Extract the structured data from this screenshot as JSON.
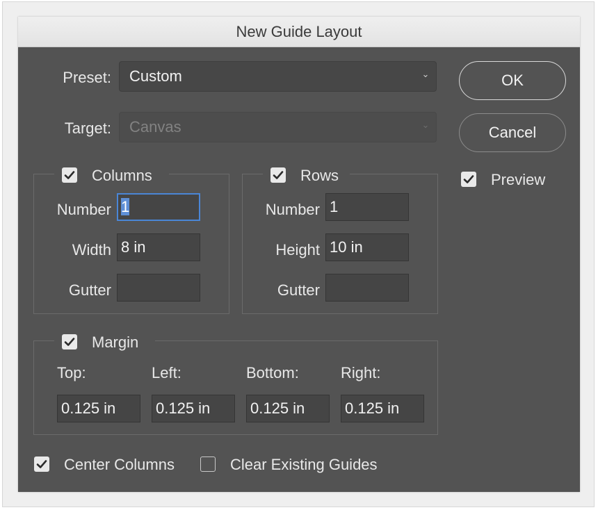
{
  "dialog": {
    "title": "New Guide Layout"
  },
  "preset": {
    "label": "Preset:",
    "value": "Custom"
  },
  "target": {
    "label": "Target:",
    "value": "Canvas"
  },
  "buttons": {
    "ok": "OK",
    "cancel": "Cancel"
  },
  "preview": {
    "label": "Preview",
    "checked": true
  },
  "columns": {
    "label": "Columns",
    "checked": true,
    "number_label": "Number",
    "number": "1",
    "width_label": "Width",
    "width": "8 in",
    "gutter_label": "Gutter",
    "gutter": ""
  },
  "rows": {
    "label": "Rows",
    "checked": true,
    "number_label": "Number",
    "number": "1",
    "height_label": "Height",
    "height": "10 in",
    "gutter_label": "Gutter",
    "gutter": ""
  },
  "margin": {
    "label": "Margin",
    "checked": true,
    "top_label": "Top:",
    "top": "0.125 in",
    "left_label": "Left:",
    "left": "0.125 in",
    "bottom_label": "Bottom:",
    "bottom": "0.125 in",
    "right_label": "Right:",
    "right": "0.125 in"
  },
  "options": {
    "center_columns": {
      "label": "Center Columns",
      "checked": true
    },
    "clear_guides": {
      "label": "Clear Existing Guides",
      "checked": false
    }
  },
  "colors": {
    "dialog_bg": "#535353",
    "focus": "#4a86d6"
  }
}
